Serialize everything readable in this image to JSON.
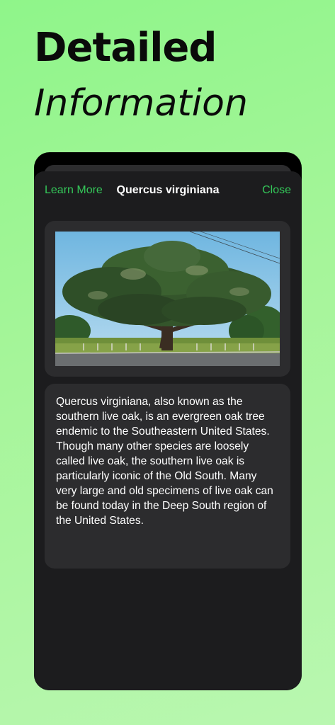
{
  "hero": {
    "title": "Detailed",
    "subtitle": "Information"
  },
  "sheet": {
    "nav": {
      "left_label": "Learn More",
      "title": "Quercus virginiana",
      "right_label": "Close"
    },
    "image_subject": "live-oak-tree-photo",
    "description": "Quercus virginiana, also known as the southern live oak, is an evergreen oak tree endemic to the Southeastern United States. Though many other species are loosely called live oak, the southern live oak is particularly iconic of the Old South. Many very large and old specimens of live oak can be found today in the Deep South region of the United States."
  },
  "colors": {
    "background": "#9cf592",
    "accent": "#34c759",
    "sheet": "#1c1c1e",
    "card": "#2c2c2e"
  }
}
